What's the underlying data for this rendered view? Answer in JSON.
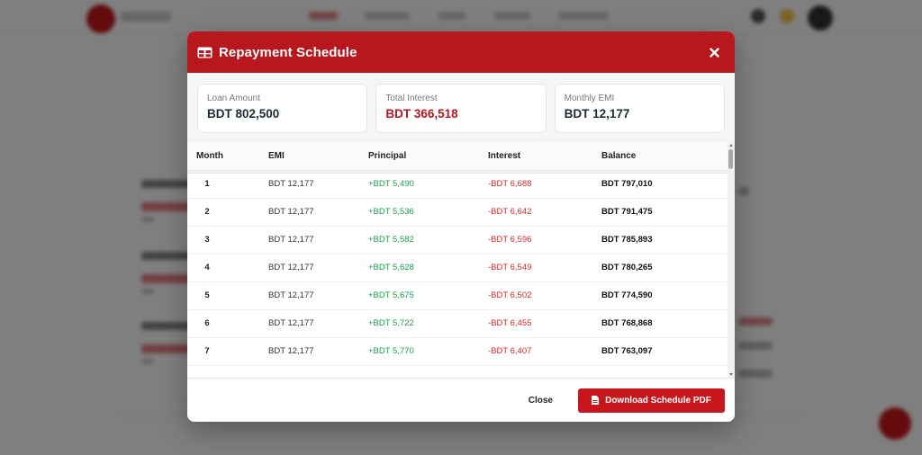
{
  "modal": {
    "title": "Repayment Schedule",
    "icon": "table-icon",
    "close_icon": "close-icon"
  },
  "summary": {
    "loan_amount": {
      "label": "Loan Amount",
      "value": "BDT 802,500"
    },
    "total_interest": {
      "label": "Total Interest",
      "value": "BDT 366,518",
      "color": "#b8171e"
    },
    "monthly_emi": {
      "label": "Monthly EMI",
      "value": "BDT 12,177"
    }
  },
  "table": {
    "headers": {
      "month": "Month",
      "emi": "EMI",
      "principal": "Principal",
      "interest": "Interest",
      "balance": "Balance"
    },
    "rows": [
      {
        "month": "1",
        "emi": "BDT 12,177",
        "principal": "+BDT 5,490",
        "interest": "-BDT 6,688",
        "balance": "BDT 797,010"
      },
      {
        "month": "2",
        "emi": "BDT 12,177",
        "principal": "+BDT 5,536",
        "interest": "-BDT 6,642",
        "balance": "BDT 791,475"
      },
      {
        "month": "3",
        "emi": "BDT 12,177",
        "principal": "+BDT 5,582",
        "interest": "-BDT 6,596",
        "balance": "BDT 785,893"
      },
      {
        "month": "4",
        "emi": "BDT 12,177",
        "principal": "+BDT 5,628",
        "interest": "-BDT 6,549",
        "balance": "BDT 780,265"
      },
      {
        "month": "5",
        "emi": "BDT 12,177",
        "principal": "+BDT 5,675",
        "interest": "-BDT 6,502",
        "balance": "BDT 774,590"
      },
      {
        "month": "6",
        "emi": "BDT 12,177",
        "principal": "+BDT 5,722",
        "interest": "-BDT 6,455",
        "balance": "BDT 768,868"
      },
      {
        "month": "7",
        "emi": "BDT 12,177",
        "principal": "+BDT 5,770",
        "interest": "-BDT 6,407",
        "balance": "BDT 763,097"
      }
    ]
  },
  "footer": {
    "close_label": "Close",
    "download_label": "Download Schedule PDF",
    "download_icon": "pdf-file-icon"
  },
  "colors": {
    "brand": "#b8171e",
    "positive": "#16a34a",
    "negative": "#dc2626"
  }
}
